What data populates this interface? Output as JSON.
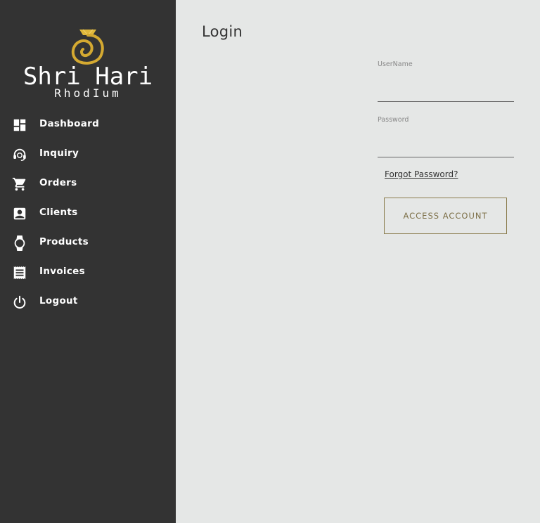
{
  "brand": {
    "title": "Shri Hari",
    "subtitle": "RhodIum",
    "gold_color": "#d4a931",
    "logo_icon": "gold-ring-icon"
  },
  "sidebar": {
    "background": "#333333",
    "items": [
      {
        "label": "Dashboard",
        "icon": "dashboard-icon"
      },
      {
        "label": "Inquiry",
        "icon": "headset-icon"
      },
      {
        "label": "Orders",
        "icon": "cart-icon"
      },
      {
        "label": "Clients",
        "icon": "contact-icon"
      },
      {
        "label": "Products",
        "icon": "watch-icon"
      },
      {
        "label": "Invoices",
        "icon": "receipt-icon"
      },
      {
        "label": "Logout",
        "icon": "power-icon"
      }
    ]
  },
  "main": {
    "title": "Login",
    "background": "#e5e7e6"
  },
  "form": {
    "username_label": "UserName",
    "username_value": "",
    "password_label": "Password",
    "password_value": "",
    "forgot_label": "Forgot Password?",
    "submit_label": "ACCESS ACCOUNT",
    "accent_color": "#8a7c4c"
  }
}
